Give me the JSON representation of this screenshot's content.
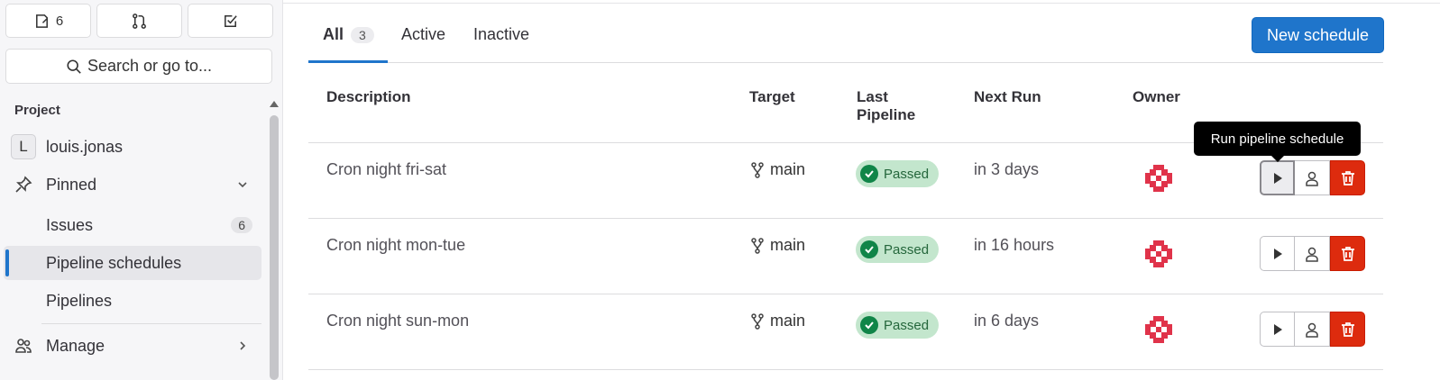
{
  "sidebar": {
    "top_buttons": [
      {
        "icon": "issues-icon",
        "count": "6"
      },
      {
        "icon": "merge-request-icon",
        "count": ""
      },
      {
        "icon": "todo-icon",
        "count": ""
      }
    ],
    "search_label": "Search or go to...",
    "section_title": "Project",
    "project": {
      "initial": "L",
      "name": "louis.jonas"
    },
    "pinned_label": "Pinned",
    "items": [
      {
        "label": "Issues",
        "count": "6"
      },
      {
        "label": "Pipeline schedules",
        "count": ""
      },
      {
        "label": "Pipelines",
        "count": ""
      }
    ],
    "manage_label": "Manage"
  },
  "tabs": [
    {
      "label": "All",
      "count": "3"
    },
    {
      "label": "Active",
      "count": ""
    },
    {
      "label": "Inactive",
      "count": ""
    }
  ],
  "new_schedule_label": "New schedule",
  "table": {
    "headers": {
      "description": "Description",
      "target": "Target",
      "last_pipeline_1": "Last",
      "last_pipeline_2": "Pipeline",
      "next_run": "Next Run",
      "owner": "Owner"
    },
    "rows": [
      {
        "description": "Cron night fri-sat",
        "target": "main",
        "status": "Passed",
        "next_run": "in 3 days"
      },
      {
        "description": "Cron night mon-tue",
        "target": "main",
        "status": "Passed",
        "next_run": "in 16 hours"
      },
      {
        "description": "Cron night sun-mon",
        "target": "main",
        "status": "Passed",
        "next_run": "in 6 days"
      }
    ]
  },
  "tooltip": "Run pipeline schedule",
  "colors": {
    "accent": "#1f75cb",
    "danger": "#dd2b0e",
    "success": "#108548",
    "success_bg": "#c3e6cd"
  }
}
